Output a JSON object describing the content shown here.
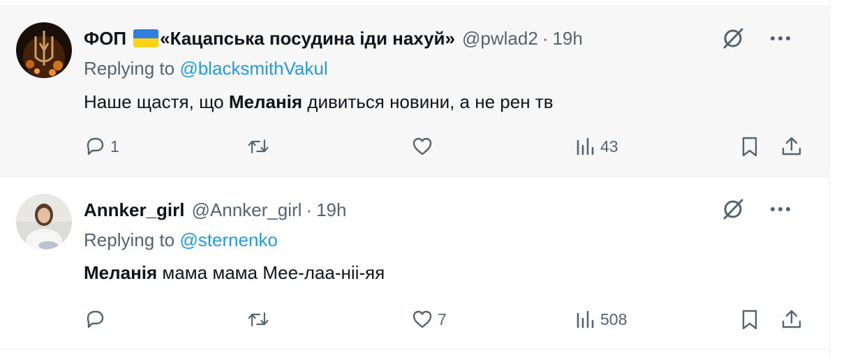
{
  "tweets": [
    {
      "name": "ФОП",
      "name_rest": "«Кацапська посудина іди нахуй»",
      "handle": "@pwlad2",
      "separator": "·",
      "time": "19h",
      "replying_prefix": "Replying to",
      "replying_to": "@blacksmithVakul",
      "text_before": "Наше щастя, що ",
      "text_bold": "Меланія",
      "text_after": " дивиться новини, а не рен тв",
      "replies": "1",
      "retweets": "",
      "likes": "",
      "views": "43"
    },
    {
      "name": "Annker_girl",
      "handle": "@Annker_girl",
      "separator": "·",
      "time": "19h",
      "replying_prefix": "Replying to",
      "replying_to": "@sternenko",
      "text_bold": "Меланія",
      "text_after": " мама мама Мее-лаа-ніі-яя",
      "replies": "",
      "retweets": "",
      "likes": "7",
      "views": "508"
    }
  ],
  "colors": {
    "text_primary": "#0f1419",
    "text_secondary": "#536471",
    "link": "#1d9bf0",
    "hover_bg": "#f7f7f7"
  },
  "icons": [
    "grok-icon",
    "more-icon",
    "reply-icon",
    "retweet-icon",
    "like-icon",
    "views-icon",
    "bookmark-icon",
    "share-icon",
    "ukraine-flag-emoji"
  ]
}
